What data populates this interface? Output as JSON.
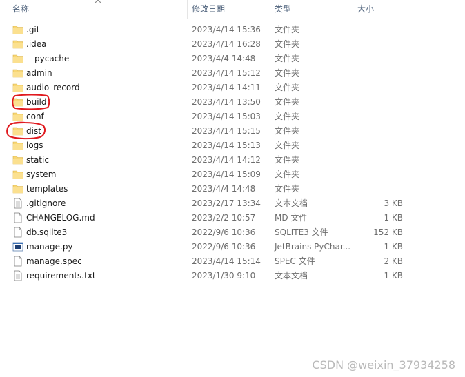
{
  "columns": {
    "name": "名称",
    "modified": "修改日期",
    "type": "类型",
    "size": "大小"
  },
  "files": [
    {
      "name": ".git",
      "modified": "2023/4/14 15:36",
      "type": "文件夹",
      "size": "",
      "icon": "folder-icon"
    },
    {
      "name": ".idea",
      "modified": "2023/4/14 16:28",
      "type": "文件夹",
      "size": "",
      "icon": "folder-icon"
    },
    {
      "name": "__pycache__",
      "modified": "2023/4/4 14:48",
      "type": "文件夹",
      "size": "",
      "icon": "folder-icon"
    },
    {
      "name": "admin",
      "modified": "2023/4/14 15:12",
      "type": "文件夹",
      "size": "",
      "icon": "folder-icon"
    },
    {
      "name": "audio_record",
      "modified": "2023/4/14 14:11",
      "type": "文件夹",
      "size": "",
      "icon": "folder-icon"
    },
    {
      "name": "build",
      "modified": "2023/4/14 13:50",
      "type": "文件夹",
      "size": "",
      "icon": "folder-icon"
    },
    {
      "name": "conf",
      "modified": "2023/4/14 15:03",
      "type": "文件夹",
      "size": "",
      "icon": "folder-icon"
    },
    {
      "name": "dist",
      "modified": "2023/4/14 15:15",
      "type": "文件夹",
      "size": "",
      "icon": "folder-icon"
    },
    {
      "name": "logs",
      "modified": "2023/4/14 15:13",
      "type": "文件夹",
      "size": "",
      "icon": "folder-icon"
    },
    {
      "name": "static",
      "modified": "2023/4/14 14:12",
      "type": "文件夹",
      "size": "",
      "icon": "folder-icon"
    },
    {
      "name": "system",
      "modified": "2023/4/14 15:09",
      "type": "文件夹",
      "size": "",
      "icon": "folder-icon"
    },
    {
      "name": "templates",
      "modified": "2023/4/4 14:48",
      "type": "文件夹",
      "size": "",
      "icon": "folder-icon"
    },
    {
      "name": ".gitignore",
      "modified": "2023/2/17 13:34",
      "type": "文本文档",
      "size": "3 KB",
      "icon": "text-document-icon"
    },
    {
      "name": "CHANGELOG.md",
      "modified": "2023/2/2 10:57",
      "type": "MD 文件",
      "size": "1 KB",
      "icon": "file-icon"
    },
    {
      "name": "db.sqlite3",
      "modified": "2022/9/6 10:36",
      "type": "SQLITE3 文件",
      "size": "152 KB",
      "icon": "file-icon"
    },
    {
      "name": "manage.py",
      "modified": "2022/9/6 10:36",
      "type": "JetBrains PyChar...",
      "size": "1 KB",
      "icon": "python-file-icon"
    },
    {
      "name": "manage.spec",
      "modified": "2023/4/14 15:14",
      "type": "SPEC 文件",
      "size": "2 KB",
      "icon": "file-icon"
    },
    {
      "name": "requirements.txt",
      "modified": "2023/1/30 9:10",
      "type": "文本文档",
      "size": "1 KB",
      "icon": "text-document-icon"
    }
  ],
  "annotations": [
    "build",
    "dist"
  ],
  "annotation_color": "#e0191e",
  "folder_color": "#f8d775",
  "watermark": "CSDN @weixin_37934258"
}
